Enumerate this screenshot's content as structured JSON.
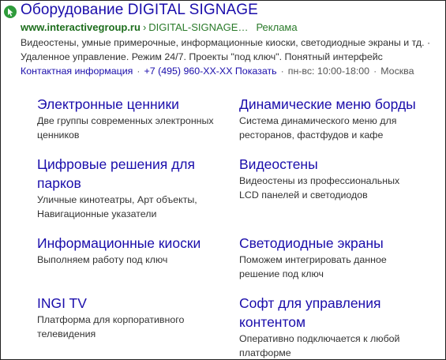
{
  "ad": {
    "favicon": "arrow-cursor-icon",
    "title": "Оборудование DIGITAL SIGNAGE",
    "domain": "www.interactivegroup.ru",
    "breadcrumb_sep": "›",
    "path": "DIGITAL-SIGNAGE…",
    "ad_label": "Реклама",
    "description": "Видеостены, умные примерочные, информационные киоски, светодиодные экраны и тд. · Удаленное управление. Режим 24/7. Проекты \"под ключ\". Понятный интерфейс",
    "contacts": {
      "contact_info": "Контактная информация",
      "phone": "+7 (495) 960-XX-XX",
      "show": "Показать",
      "hours": "пн-вс: 10:00-18:00",
      "city": "Москва"
    }
  },
  "sitelinks": [
    {
      "title": "Электронные ценники",
      "desc": "Две группы современных электронных ценников"
    },
    {
      "title": "Динамические меню борды",
      "desc": "Система динамического меню для ресторанов, фастфудов и кафе"
    },
    {
      "title": "Цифровые решения для парков",
      "desc": "Уличные кинотеатры, Арт объекты, Навигационные указатели"
    },
    {
      "title": "Видеостены",
      "desc": "Видеостены из профессиональных LCD панелей и светодиодов"
    },
    {
      "title": "Информационные киоски",
      "desc": "Выполняем работу под ключ"
    },
    {
      "title": "Светодиодные экраны",
      "desc": "Поможем интегрировать данное решение под ключ"
    },
    {
      "title": "INGI TV",
      "desc": "Платформа для корпоративного телевидения"
    },
    {
      "title": "Софт для управления контентом",
      "desc": "Оперативно подключается к любой платформе"
    }
  ],
  "colors": {
    "link": "#1a0dab",
    "url_green": "#2a7a2a",
    "text": "#333333",
    "favicon_bg": "#2e9b3a"
  }
}
